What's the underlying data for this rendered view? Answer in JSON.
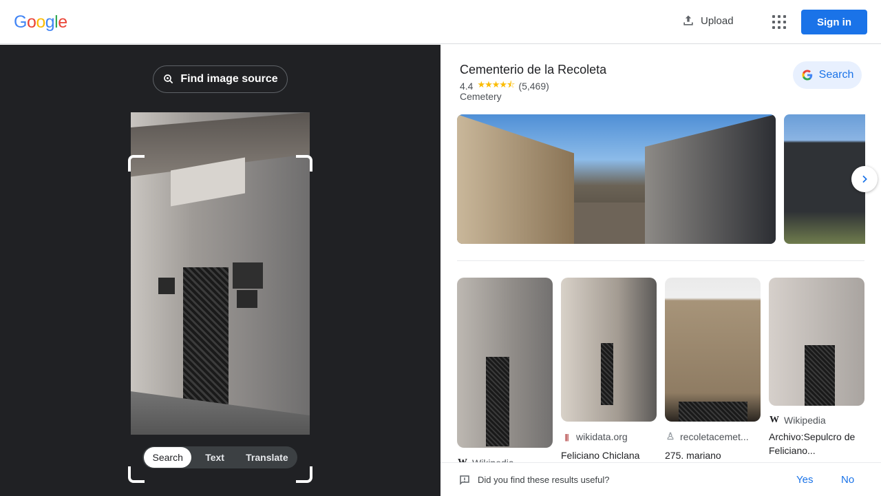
{
  "header": {
    "logo": [
      "G",
      "o",
      "o",
      "g",
      "l",
      "e"
    ],
    "logo_colors": [
      "#4285f4",
      "#ea4335",
      "#fbbc05",
      "#4285f4",
      "#34a853",
      "#ea4335"
    ],
    "upload_label": "Upload",
    "signin_label": "Sign in"
  },
  "lens": {
    "find_source_label": "Find image source",
    "modes": [
      "Search",
      "Text",
      "Translate"
    ],
    "active_mode": "Search"
  },
  "place": {
    "title": "Cementerio de la Recoleta",
    "rating": "4.4",
    "stars": "★★★★⯪",
    "reviews": "(5,469)",
    "category": "Cemetery",
    "search_label": "Search"
  },
  "results": [
    {
      "source": "Wikipedia",
      "title": ""
    },
    {
      "source": "wikidata.org",
      "title": "Feliciano Chiclana"
    },
    {
      "source": "recoletacemet...",
      "title": "275. mariano"
    },
    {
      "source": "Wikipedia",
      "title": "Archivo:Sepulcro de Feliciano..."
    }
  ],
  "feedback": {
    "question": "Did you find these results useful?",
    "yes": "Yes",
    "no": "No"
  }
}
